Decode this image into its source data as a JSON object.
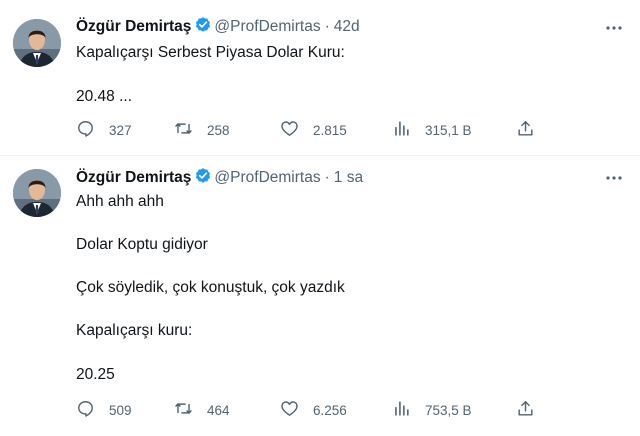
{
  "tweets": [
    {
      "author_name": "Özgür Demirtaş",
      "handle": "@ProfDemirtas",
      "separator": "·",
      "time": "42d",
      "lines": [
        "Kapalıçarşı Serbest Piyasa Dolar Kuru:",
        "20.48 ..."
      ],
      "replies": "327",
      "retweets": "258",
      "likes": "2.815",
      "views": "315,1 B"
    },
    {
      "author_name": "Özgür Demirtaş",
      "handle": "@ProfDemirtas",
      "separator": "·",
      "time": "1 sa",
      "lines": [
        "Ahh ahh ahh",
        "Dolar Koptu gidiyor",
        "Çok söyledik, çok konuştuk, çok yazdık",
        "Kapalıçarşı kuru:",
        "20.25"
      ],
      "replies": "509",
      "retweets": "464",
      "likes": "6.256",
      "views": "753,5 B"
    }
  ],
  "icons": {
    "verified": "verified-badge-icon",
    "more": "more-horizontal-icon",
    "reply": "reply-icon",
    "retweet": "retweet-icon",
    "like": "heart-icon",
    "views": "views-chart-icon",
    "share": "share-icon"
  },
  "colors": {
    "verified_blue": "#1d9bf0",
    "secondary_text": "#536471",
    "primary_text": "#0f1419",
    "divider": "#eff3f4"
  }
}
